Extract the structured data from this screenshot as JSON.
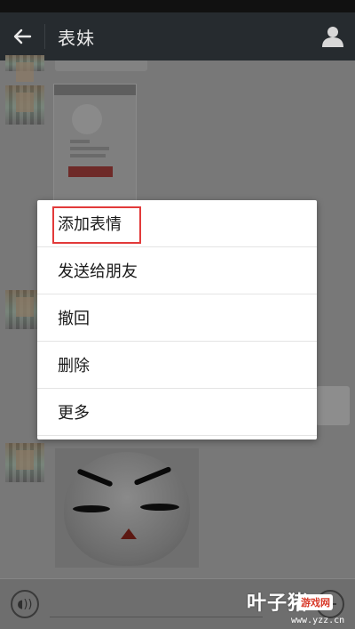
{
  "header": {
    "title": "表妹",
    "back_icon": "arrow-left-icon",
    "profile_icon": "person-icon"
  },
  "context_menu": {
    "items": [
      {
        "label": "添加表情"
      },
      {
        "label": "发送给朋友"
      },
      {
        "label": "撤回"
      },
      {
        "label": "删除"
      },
      {
        "label": "更多"
      }
    ],
    "highlight_color": "#e23a3a"
  },
  "input_bar": {
    "voice_icon": "voice-icon",
    "plus_icon": "plus-icon"
  },
  "watermark": {
    "brand": "叶子猪",
    "badge": "游戏网",
    "url": "www.yzz.cn"
  },
  "colors": {
    "titlebar": "#262b2f",
    "overlay": "#7c7c7c",
    "menu_bg": "#ffffff"
  }
}
